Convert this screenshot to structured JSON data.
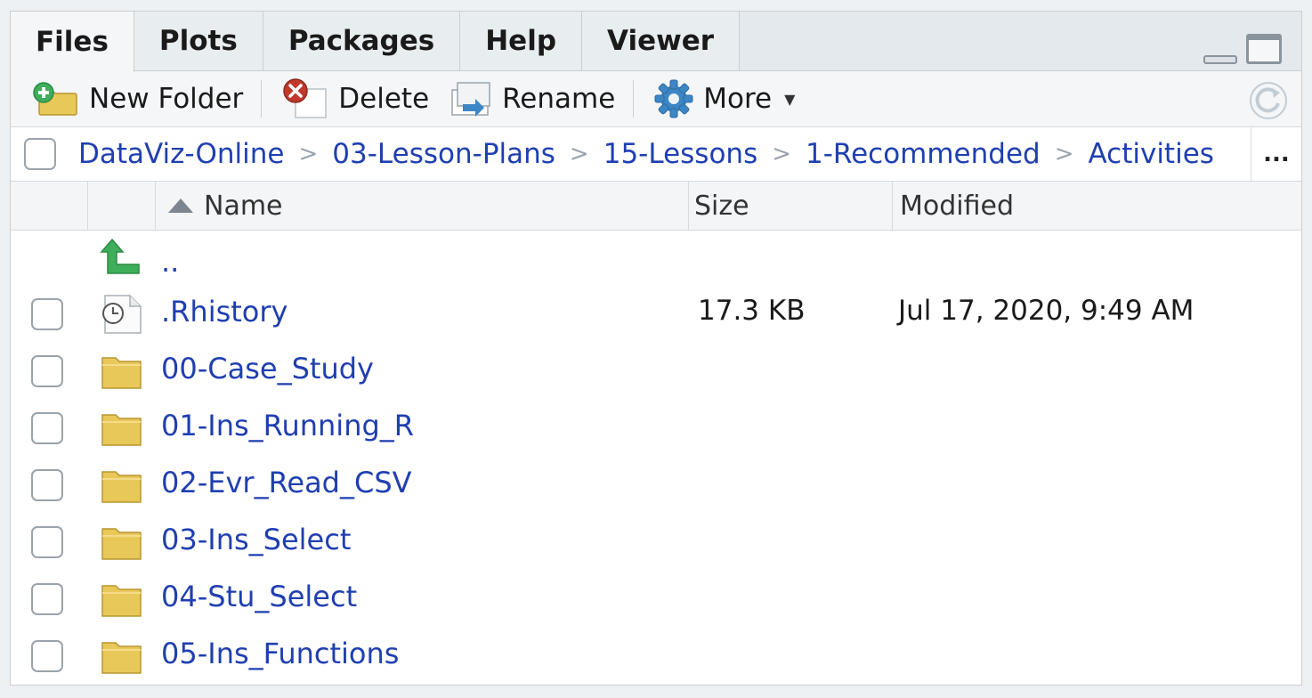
{
  "tabs": [
    {
      "label": "Files",
      "active": true
    },
    {
      "label": "Plots",
      "active": false
    },
    {
      "label": "Packages",
      "active": false
    },
    {
      "label": "Help",
      "active": false
    },
    {
      "label": "Viewer",
      "active": false
    }
  ],
  "toolbar": {
    "new_folder_label": "New Folder",
    "delete_label": "Delete",
    "rename_label": "Rename",
    "more_label": "More"
  },
  "breadcrumb": {
    "items": [
      "DataViz-Online",
      "03-Lesson-Plans",
      "15-Lessons",
      "1-Recommended",
      "Activities"
    ],
    "overflow_label": "..."
  },
  "columns": {
    "name": "Name",
    "size": "Size",
    "modified": "Modified"
  },
  "parent_row": {
    "name": ".."
  },
  "files": [
    {
      "name": ".Rhistory",
      "size": "17.3 KB",
      "modified": "Jul 17, 2020, 9:49 AM",
      "icon": "history-file-icon"
    },
    {
      "name": "00-Case_Study",
      "size": "",
      "modified": "",
      "icon": "folder-icon"
    },
    {
      "name": "01-Ins_Running_R",
      "size": "",
      "modified": "",
      "icon": "folder-icon"
    },
    {
      "name": "02-Evr_Read_CSV",
      "size": "",
      "modified": "",
      "icon": "folder-icon"
    },
    {
      "name": "03-Ins_Select",
      "size": "",
      "modified": "",
      "icon": "folder-icon"
    },
    {
      "name": "04-Stu_Select",
      "size": "",
      "modified": "",
      "icon": "folder-icon"
    },
    {
      "name": "05-Ins_Functions",
      "size": "",
      "modified": "",
      "icon": "folder-icon"
    }
  ],
  "colors": {
    "link": "#1f3fb0",
    "folder": "#e9c85a",
    "up_arrow": "#3fae5a",
    "delete_red": "#c0392b",
    "gear_blue": "#3d86c6"
  }
}
